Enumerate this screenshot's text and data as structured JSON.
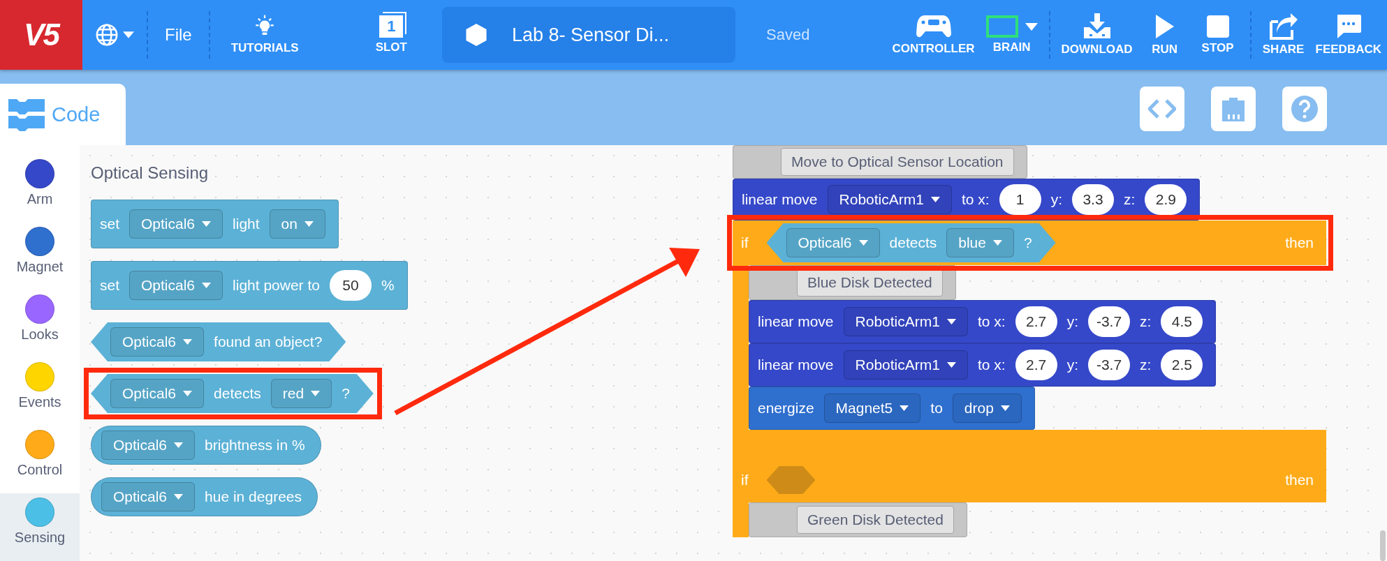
{
  "header": {
    "logo": "V5",
    "file": "File",
    "tutorials": "TUTORIALS",
    "slot": {
      "number": "1",
      "label": "SLOT"
    },
    "project_title": "Lab 8- Sensor Di...",
    "save_status": "Saved",
    "buttons": [
      {
        "kind": "controller",
        "label": "CONTROLLER"
      },
      {
        "kind": "brain",
        "label": "BRAIN"
      },
      {
        "kind": "download",
        "label": "DOWNLOAD"
      },
      {
        "kind": "run",
        "label": "RUN"
      },
      {
        "kind": "stop",
        "label": "STOP"
      },
      {
        "kind": "share",
        "label": "SHARE"
      },
      {
        "kind": "feedback",
        "label": "FEEDBACK"
      }
    ]
  },
  "editor_tabs": [
    {
      "label": "Code",
      "selected": true
    }
  ],
  "categories": [
    {
      "label": "Arm",
      "color": "#3548c9",
      "selected": false
    },
    {
      "label": "Magnet",
      "color": "#2f6fce",
      "selected": false
    },
    {
      "label": "Looks",
      "color": "#9966ff",
      "selected": false
    },
    {
      "label": "Events",
      "color": "#ffd500",
      "selected": false
    },
    {
      "label": "Control",
      "color": "#ffab19",
      "selected": false
    },
    {
      "label": "Sensing",
      "color": "#4cbfe6",
      "selected": true
    }
  ],
  "palette": {
    "title": "Optical Sensing",
    "blocks": [
      {
        "kind": "statement",
        "color": "#5cb1d6",
        "highlighted": false,
        "parts": [
          {
            "kind": "text",
            "text": "set"
          },
          {
            "kind": "dropdown",
            "text": "Optical6"
          },
          {
            "kind": "text",
            "text": "light"
          },
          {
            "kind": "dropdown",
            "text": "on"
          }
        ]
      },
      {
        "kind": "statement",
        "color": "#5cb1d6",
        "highlighted": false,
        "parts": [
          {
            "kind": "text",
            "text": "set"
          },
          {
            "kind": "dropdown",
            "text": "Optical6"
          },
          {
            "kind": "text",
            "text": "light power to"
          },
          {
            "kind": "number",
            "text": "50"
          },
          {
            "kind": "text",
            "text": "%"
          }
        ]
      },
      {
        "kind": "boolean",
        "color": "#5cb1d6",
        "highlighted": false,
        "parts": [
          {
            "kind": "dropdown",
            "text": "Optical6"
          },
          {
            "kind": "text",
            "text": "found an object?"
          }
        ]
      },
      {
        "kind": "boolean",
        "color": "#5cb1d6",
        "highlighted": true,
        "parts": [
          {
            "kind": "dropdown",
            "text": "Optical6"
          },
          {
            "kind": "text",
            "text": "detects"
          },
          {
            "kind": "dropdown",
            "text": "red"
          },
          {
            "kind": "text",
            "text": "?"
          }
        ]
      },
      {
        "kind": "reporter",
        "color": "#5cb1d6",
        "highlighted": false,
        "parts": [
          {
            "kind": "dropdown",
            "text": "Optical6"
          },
          {
            "kind": "text",
            "text": "brightness in %"
          }
        ]
      },
      {
        "kind": "reporter",
        "color": "#5cb1d6",
        "highlighted": false,
        "parts": [
          {
            "kind": "dropdown",
            "text": "Optical6"
          },
          {
            "kind": "text",
            "text": "hue in degrees"
          }
        ]
      }
    ]
  },
  "workspace": {
    "stack": [
      {
        "kind": "note",
        "color": "#c6c6c6",
        "parts": [
          {
            "kind": "field",
            "text": "Move to Optical Sensor Location"
          }
        ]
      },
      {
        "kind": "statement",
        "color": "#3548c9",
        "parts": [
          {
            "kind": "text",
            "text": "linear move"
          },
          {
            "kind": "dropdown",
            "text": "RoboticArm1"
          },
          {
            "kind": "text",
            "text": "to x:"
          },
          {
            "kind": "number",
            "text": "1"
          },
          {
            "kind": "text",
            "text": "y:"
          },
          {
            "kind": "number",
            "text": "3.3"
          },
          {
            "kind": "text",
            "text": "z:"
          },
          {
            "kind": "number",
            "text": "2.9"
          }
        ]
      },
      {
        "kind": "if",
        "color": "#ffab19",
        "highlighted": true,
        "label": "if",
        "then_label": "then",
        "condition": {
          "kind": "boolean",
          "color": "#5cb1d6",
          "parts": [
            {
              "kind": "dropdown",
              "text": "Optical6"
            },
            {
              "kind": "text",
              "text": "detects"
            },
            {
              "kind": "dropdown",
              "text": "blue"
            },
            {
              "kind": "text",
              "text": "?"
            }
          ]
        },
        "children": [
          {
            "kind": "note",
            "color": "#c6c6c6",
            "parts": [
              {
                "kind": "field",
                "text": "Blue Disk Detected"
              }
            ]
          },
          {
            "kind": "statement",
            "color": "#3548c9",
            "parts": [
              {
                "kind": "text",
                "text": "linear move"
              },
              {
                "kind": "dropdown",
                "text": "RoboticArm1"
              },
              {
                "kind": "text",
                "text": "to x:"
              },
              {
                "kind": "number",
                "text": "2.7"
              },
              {
                "kind": "text",
                "text": "y:"
              },
              {
                "kind": "number",
                "text": "-3.7"
              },
              {
                "kind": "text",
                "text": "z:"
              },
              {
                "kind": "number",
                "text": "4.5"
              }
            ]
          },
          {
            "kind": "statement",
            "color": "#3548c9",
            "parts": [
              {
                "kind": "text",
                "text": "linear move"
              },
              {
                "kind": "dropdown",
                "text": "RoboticArm1"
              },
              {
                "kind": "text",
                "text": "to x:"
              },
              {
                "kind": "number",
                "text": "2.7"
              },
              {
                "kind": "text",
                "text": "y:"
              },
              {
                "kind": "number",
                "text": "-3.7"
              },
              {
                "kind": "text",
                "text": "z:"
              },
              {
                "kind": "number",
                "text": "2.5"
              }
            ]
          },
          {
            "kind": "statement",
            "color": "#2f6fce",
            "parts": [
              {
                "kind": "text",
                "text": "energize"
              },
              {
                "kind": "dropdown",
                "text": "Magnet5"
              },
              {
                "kind": "text",
                "text": "to"
              },
              {
                "kind": "dropdown",
                "text": "drop"
              }
            ]
          }
        ]
      },
      {
        "kind": "if",
        "color": "#ffab19",
        "highlighted": false,
        "label": "if",
        "then_label": "then",
        "children": [
          {
            "kind": "note",
            "color": "#c6c6c6",
            "parts": [
              {
                "kind": "field",
                "text": "Green Disk Detected"
              }
            ]
          }
        ]
      }
    ]
  }
}
